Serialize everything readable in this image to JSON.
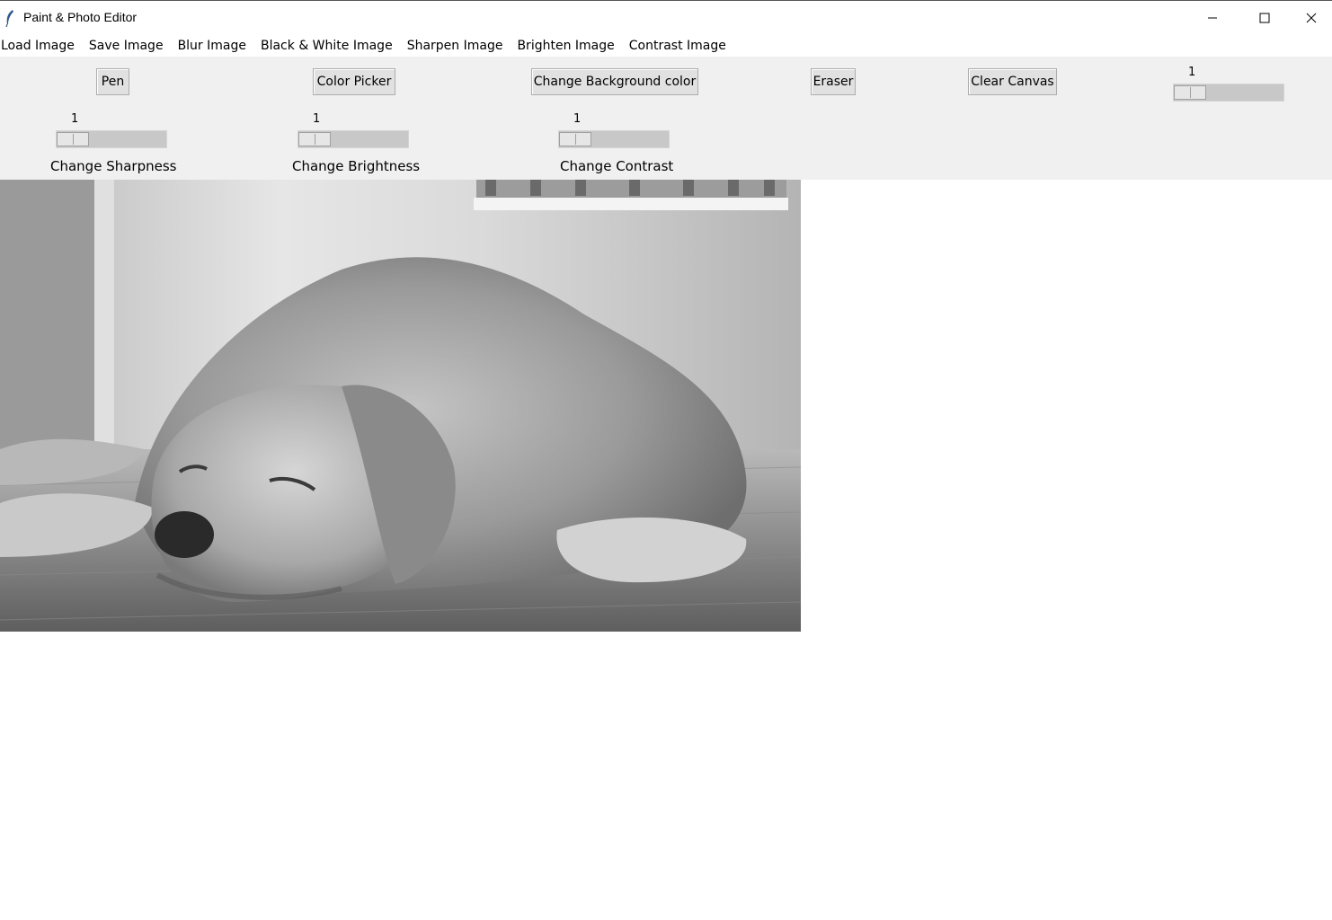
{
  "window": {
    "title": "Paint & Photo Editor"
  },
  "menu": {
    "items": [
      "Load Image",
      "Save Image",
      "Blur Image",
      "Black & White Image",
      "Sharpen Image",
      "Brighten Image",
      "Contrast Image"
    ]
  },
  "toolbar": {
    "pen_label": "Pen",
    "color_picker_label": "Color Picker",
    "bg_color_label": "Change Background color",
    "eraser_label": "Eraser",
    "clear_label": "Clear Canvas",
    "pen_size_value": "1"
  },
  "adjustments": {
    "sharpness": {
      "value": "1",
      "label": "Change Sharpness"
    },
    "brightness": {
      "value": "1",
      "label": "Change Brightness"
    },
    "contrast": {
      "value": "1",
      "label": "Change Contrast"
    }
  },
  "canvas": {
    "image_subject": "golden retriever lying on wood floor (grayscale photo)",
    "background_color": "#ffffff"
  }
}
